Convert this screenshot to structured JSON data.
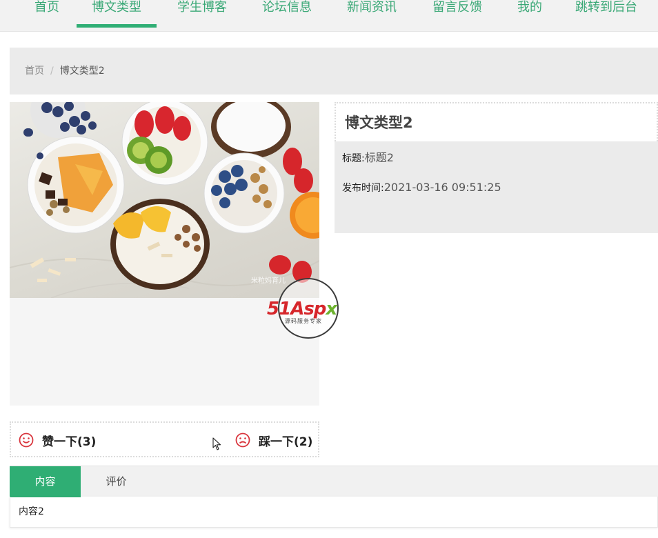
{
  "nav": {
    "items": [
      {
        "label": "首页"
      },
      {
        "label": "博文类型"
      },
      {
        "label": "学生博客"
      },
      {
        "label": "论坛信息"
      },
      {
        "label": "新闻资讯"
      },
      {
        "label": "留言反馈"
      },
      {
        "label": "我的"
      },
      {
        "label": "跳转到后台"
      }
    ],
    "active": "博文类型",
    "accent": "#2fae74"
  },
  "breadcrumb": {
    "home": "首页",
    "separator": "/",
    "current": "博文类型2"
  },
  "detail": {
    "heading": "博文类型2",
    "title_label": "标题:",
    "title_value": "标题2",
    "time_label": "发布时间:",
    "time_value": "2021-03-16 09:51:25"
  },
  "image": {
    "watermark_caption": "米粒妈育儿",
    "icon": "photo-food-bowls"
  },
  "watermark": {
    "brand_red": "51",
    "brand_black": "A",
    "brand_red2": "sp",
    "brand_green": "x",
    "tagline": "源码服务专家"
  },
  "reactions": {
    "like": {
      "label": "赞一下(3)",
      "icon": "smile-icon"
    },
    "dislike": {
      "label": "踩一下(2)",
      "icon": "frown-icon"
    },
    "icon_color": "#d9363e"
  },
  "tabs": {
    "items": [
      {
        "label": "内容"
      },
      {
        "label": "评价"
      }
    ],
    "active": "内容",
    "content": "内容2"
  }
}
